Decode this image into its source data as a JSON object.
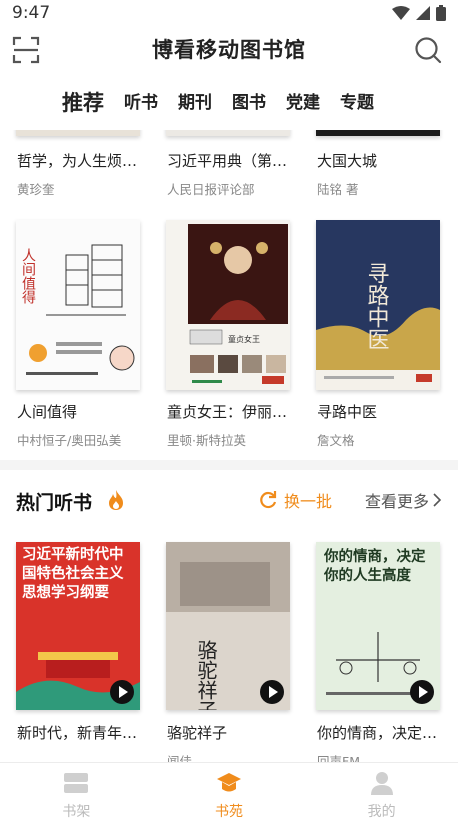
{
  "status_bar": {
    "time": "9:47"
  },
  "header": {
    "title": "博看移动图书馆"
  },
  "tabs": [
    {
      "label": "推荐",
      "active": true
    },
    {
      "label": "听书",
      "active": false
    },
    {
      "label": "期刊",
      "active": false
    },
    {
      "label": "图书",
      "active": false
    },
    {
      "label": "党建",
      "active": false
    },
    {
      "label": "专题",
      "active": false
    }
  ],
  "books_row1": [
    {
      "title": "哲学，为人生烦…",
      "author": "黄珍奎"
    },
    {
      "title": "习近平用典（第…",
      "author": "人民日报评论部"
    },
    {
      "title": "大国大城",
      "author": "陆铭 著"
    }
  ],
  "books_row2": [
    {
      "title": "人间值得",
      "author": "中村恒子/奥田弘美",
      "cover_text": "人间值得"
    },
    {
      "title": "童贞女王：伊丽…",
      "author": "里顿·斯特拉英",
      "cover_text": "童贞女王"
    },
    {
      "title": "寻路中医",
      "author": "詹文格",
      "cover_text": "寻路中医"
    }
  ],
  "audio_section": {
    "title": "热门听书",
    "refresh_label": "换一批",
    "more_label": "查看更多",
    "items": [
      {
        "title": "新时代，新青年…",
        "author": "",
        "cover_text": "习近平新时代中国特色社会主义思想学习纲要"
      },
      {
        "title": "骆驼祥子",
        "author": "闻佳",
        "cover_text": "骆驼祥子"
      },
      {
        "title": "你的情商，决定…",
        "author": "回声FM",
        "cover_text": "你的情商，决定你的人生高度"
      }
    ]
  },
  "bottom_nav": [
    {
      "label": "书架",
      "active": false
    },
    {
      "label": "书苑",
      "active": true
    },
    {
      "label": "我的",
      "active": false
    }
  ],
  "colors": {
    "accent": "#f08c1c",
    "muted": "#888888"
  }
}
